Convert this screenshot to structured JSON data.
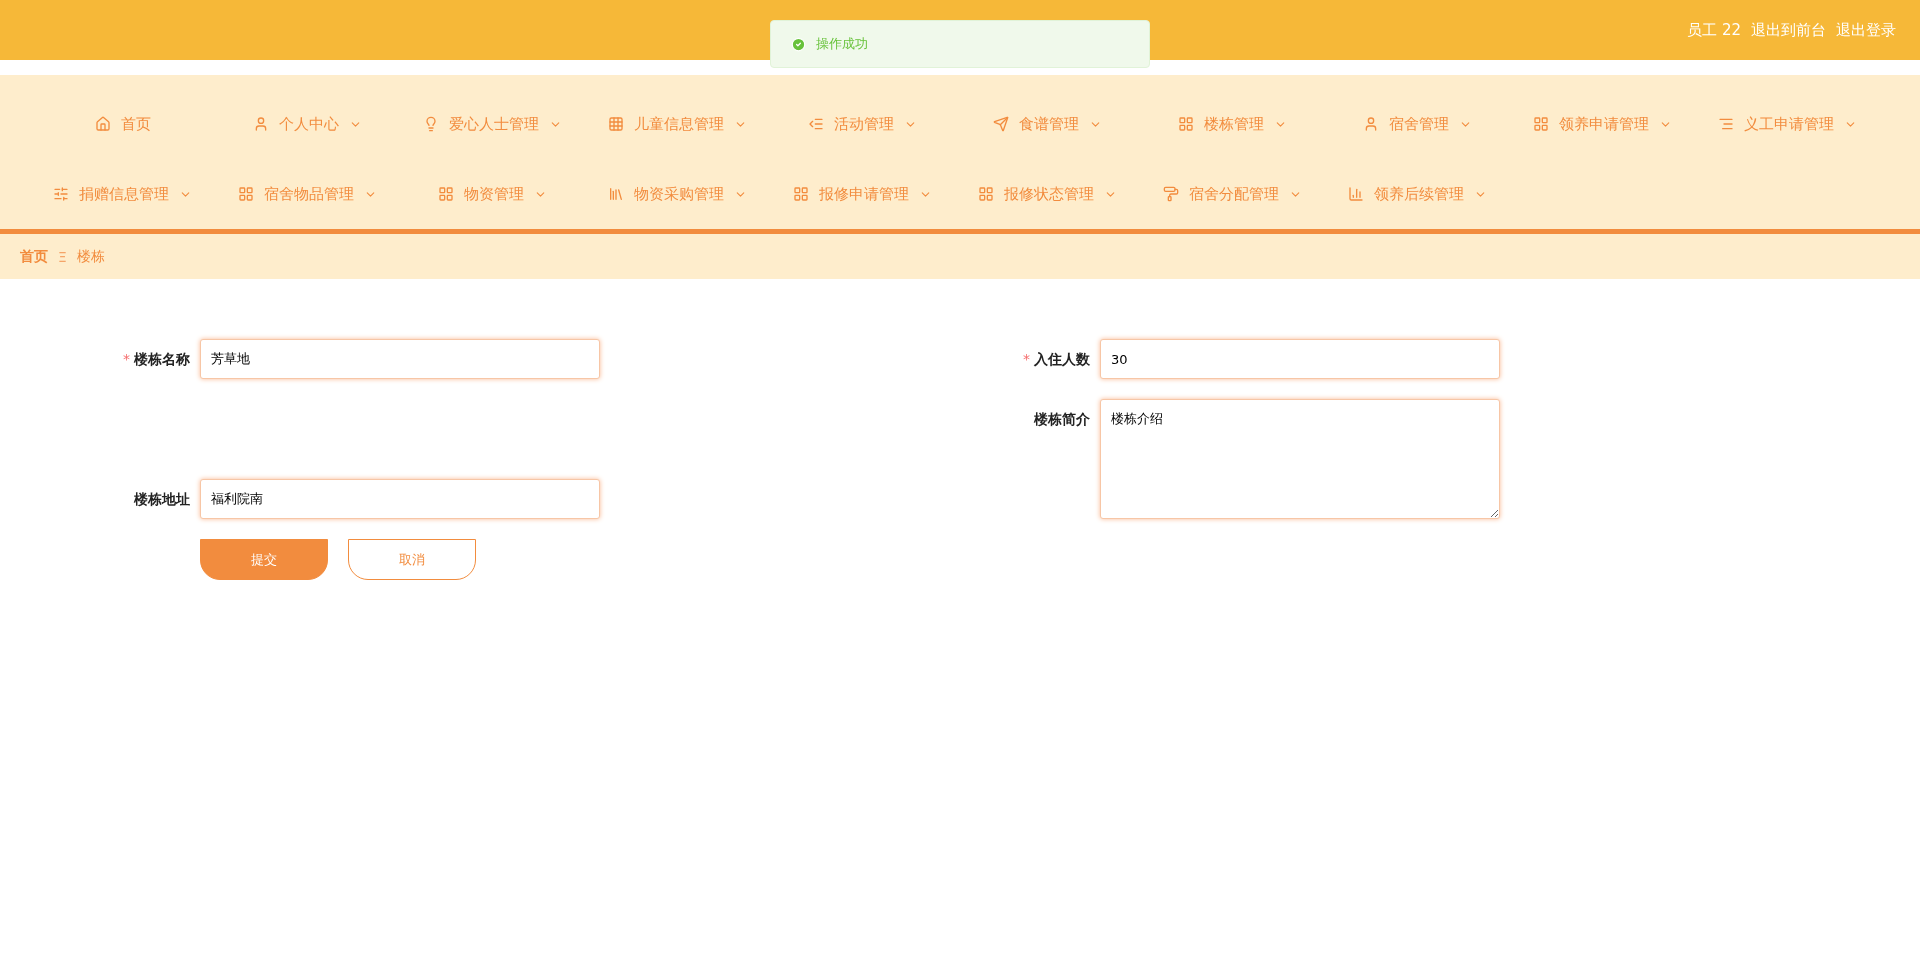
{
  "header": {
    "user": "员工 22",
    "links": [
      "退出到前台",
      "退出登录"
    ]
  },
  "toast": {
    "message": "操作成功"
  },
  "nav": {
    "items": [
      {
        "label": "首页",
        "dropdown": false
      },
      {
        "label": "个人中心",
        "dropdown": true
      },
      {
        "label": "爱心人士管理",
        "dropdown": true
      },
      {
        "label": "儿童信息管理",
        "dropdown": true
      },
      {
        "label": "活动管理",
        "dropdown": true
      },
      {
        "label": "食谱管理",
        "dropdown": true
      },
      {
        "label": "楼栋管理",
        "dropdown": true
      },
      {
        "label": "宿舍管理",
        "dropdown": true
      },
      {
        "label": "领养申请管理",
        "dropdown": true
      },
      {
        "label": "义工申请管理",
        "dropdown": true
      },
      {
        "label": "捐赠信息管理",
        "dropdown": true
      },
      {
        "label": "宿舍物品管理",
        "dropdown": true
      },
      {
        "label": "物资管理",
        "dropdown": true
      },
      {
        "label": "物资采购管理",
        "dropdown": true
      },
      {
        "label": "报修申请管理",
        "dropdown": true
      },
      {
        "label": "报修状态管理",
        "dropdown": true
      },
      {
        "label": "宿舍分配管理",
        "dropdown": true
      },
      {
        "label": "领养后续管理",
        "dropdown": true
      }
    ]
  },
  "breadcrumb": {
    "items": [
      "首页",
      "楼栋"
    ],
    "separator": "Ξ"
  },
  "form": {
    "columns": [
      [
        {
          "label": "楼栋名称",
          "required": true,
          "value": "芳草地",
          "kind": "input"
        },
        {
          "label": "楼栋地址",
          "required": false,
          "value": "福利院南",
          "kind": "input"
        }
      ],
      [
        {
          "label": "入住人数",
          "required": true,
          "value": "30",
          "kind": "input"
        },
        {
          "label": "楼栋简介",
          "required": false,
          "value": "楼栋介绍",
          "kind": "textarea"
        }
      ]
    ],
    "required_mark": "*",
    "buttons": [
      {
        "label": "提交",
        "kind": "primary"
      },
      {
        "label": "取消",
        "kind": "secondary"
      }
    ]
  }
}
